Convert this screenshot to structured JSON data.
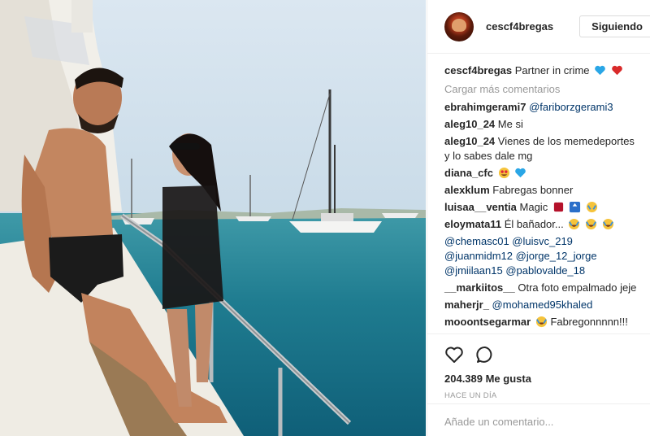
{
  "header": {
    "username": "cescf4bregas",
    "follow_label": "Siguiendo"
  },
  "caption": {
    "username": "cescf4bregas",
    "text": "Partner in crime"
  },
  "load_more": "Cargar más comentarios",
  "comments": [
    {
      "user": "ebrahimgerami7",
      "text": "",
      "mention": "@fariborzgerami3"
    },
    {
      "user": "aleg10_24",
      "text": "Me si"
    },
    {
      "user": "aleg10_24",
      "text": "Vienes de los memedeportes y lo sabes dale mg"
    },
    {
      "user": "diana_cfc",
      "text": ""
    },
    {
      "user": "alexklum",
      "text": "Fabregas bonner"
    },
    {
      "user": "luisaa__ventia",
      "text": "Magic"
    },
    {
      "user": "eloymata11",
      "text": "Él bañador..."
    },
    {
      "mentions": "@chemasc01 @luisvc_219 @juanmidm12 @jorge_12_jorge @jmiilaan15 @pablovalde_18"
    },
    {
      "user": "__markiitos__",
      "text": "Otra foto empalmado jeje"
    },
    {
      "user": "maherjr_",
      "mention": "@mohamed95khaled"
    },
    {
      "user": "mooontsegarmar",
      "text": "Fabregonnnnn!!!"
    }
  ],
  "likes": "204.389 Me gusta",
  "time_ago": "HACE UN DÍA",
  "add_comment_placeholder": "Añade un comentario...",
  "icons": {
    "like": "heart-outline-icon",
    "comment": "speech-bubble-icon"
  },
  "colors": {
    "mention": "#003569",
    "muted": "#999999",
    "border": "#efefef"
  }
}
